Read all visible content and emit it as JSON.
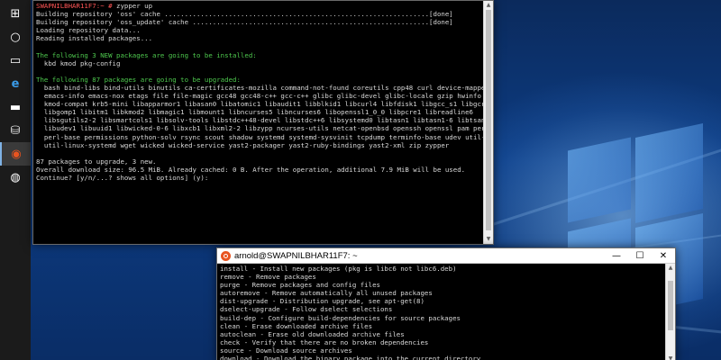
{
  "colors": {
    "prompt": "#ff5555",
    "header": "#4ec94e",
    "terminal_bg": "#000000",
    "terminal_fg": "#d8d8d8",
    "ubuntu_orange": "#e95420"
  },
  "taskbar": {
    "items": [
      {
        "name": "start-icon",
        "glyph": "⊞"
      },
      {
        "name": "search-icon",
        "glyph": "○"
      },
      {
        "name": "task-view-icon",
        "glyph": "▭"
      },
      {
        "name": "edge-icon",
        "glyph": "e"
      },
      {
        "name": "file-explorer-icon",
        "glyph": "▬"
      },
      {
        "name": "store-icon",
        "glyph": "⛁"
      },
      {
        "name": "ubuntu-icon",
        "glyph": "◉"
      },
      {
        "name": "app-icon",
        "glyph": "◍"
      }
    ]
  },
  "window1": {
    "title": "",
    "lines": [
      {
        "cls": "mix",
        "parts": [
          {
            "c": "c-prompt",
            "t": "SWAPNILBHAR11F7:~ # "
          },
          {
            "c": "",
            "t": "zypper up"
          }
        ]
      },
      {
        "cls": "",
        "t": "Building repository 'oss' cache ..................................................................[done]"
      },
      {
        "cls": "",
        "t": "Building repository 'oss_update' cache ...........................................................[done]"
      },
      {
        "cls": "",
        "t": "Loading repository data..."
      },
      {
        "cls": "",
        "t": "Reading installed packages..."
      },
      {
        "cls": "",
        "t": ""
      },
      {
        "cls": "c-green",
        "t": "The following 3 NEW packages are going to be installed:"
      },
      {
        "cls": "",
        "t": "  kbd kmod pkg-config"
      },
      {
        "cls": "",
        "t": ""
      },
      {
        "cls": "c-green",
        "t": "The following 87 packages are going to be upgraded:"
      },
      {
        "cls": "",
        "t": "  bash bind-libs bind-utils binutils ca-certificates-mozilla command-not-found coreutils cpp48 curl device-mapper emacs"
      },
      {
        "cls": "",
        "t": "  emacs-info emacs-nox etags file file-magic gcc48 gcc48-c++ gcc-c++ glibc glibc-devel glibc-locale gzip hwinfo"
      },
      {
        "cls": "",
        "t": "  kmod-compat krb5-mini libapparmor1 libasan0 libatomic1 libaudit1 libblkid1 libcurl4 libfdisk1 libgcc_s1 libgcrypt20"
      },
      {
        "cls": "",
        "t": "  libgomp1 libitm1 libkmod2 libmagic1 libmount1 libncurses5 libncurses6 libopenssl1_0_0 libpcre1 libreadline6"
      },
      {
        "cls": "",
        "t": "  libsgutils2-2 libsmartcols1 libsolv-tools libstdc++48-devel libstdc++6 libsystemd0 libtasn1 libtasn1-6 libtsan0"
      },
      {
        "cls": "",
        "t": "  libudev1 libuuid1 libwicked-0-6 libxcb1 libxml2-2 libzypp ncurses-utils netcat-openbsd openssh openssl pam perl"
      },
      {
        "cls": "",
        "t": "  perl-base permissions python-solv rsync scout shadow systemd systemd-sysvinit tcpdump terminfo-base udev util-linux"
      },
      {
        "cls": "",
        "t": "  util-linux-systemd wget wicked wicked-service yast2-packager yast2-ruby-bindings yast2-xml zip zypper"
      },
      {
        "cls": "",
        "t": ""
      },
      {
        "cls": "",
        "t": "87 packages to upgrade, 3 new."
      },
      {
        "cls": "",
        "t": "Overall download size: 96.5 MiB. Already cached: 0 B. After the operation, additional 7.9 MiB will be used."
      },
      {
        "cls": "",
        "t": "Continue? [y/n/...? shows all options] (y):"
      }
    ]
  },
  "window2": {
    "title": "arnold@SWAPNILBHAR11F7: ~",
    "lines": [
      "install - Install new packages (pkg is libc6 not libc6.deb)",
      "remove - Remove packages",
      "purge - Remove packages and config files",
      "autoremove - Remove automatically all unused packages",
      "dist-upgrade - Distribution upgrade, see apt-get(8)",
      "dselect-upgrade - Follow dselect selections",
      "build-dep - Configure build-dependencies for source packages",
      "clean - Erase downloaded archive files",
      "autoclean - Erase old downloaded archive files",
      "check - Verify that there are no broken dependencies",
      "source - Download source archives",
      "download - Download the binary package into the current directory"
    ]
  },
  "controls": {
    "minimize": "—",
    "maximize": "☐",
    "close": "✕",
    "scroll_up": "▲",
    "scroll_down": "▼"
  }
}
